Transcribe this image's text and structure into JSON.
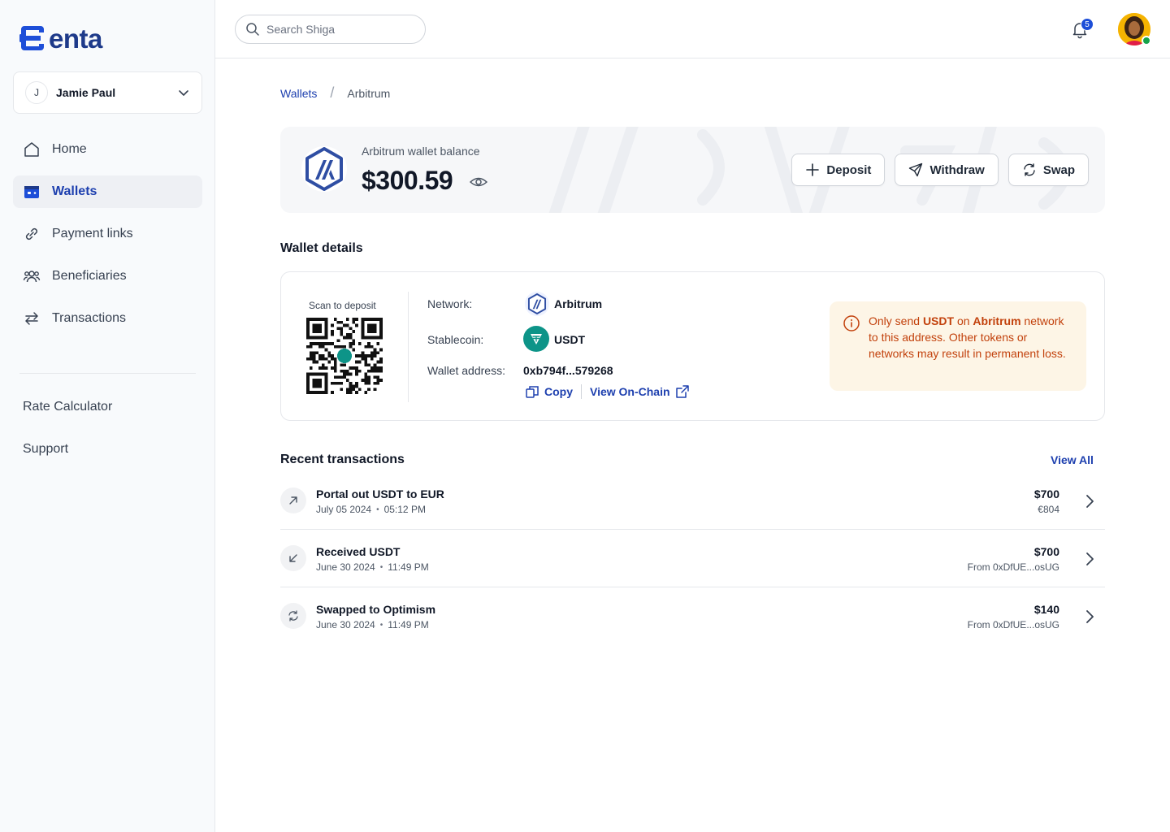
{
  "brand": {
    "name": "enta",
    "color": "#1d4ed8"
  },
  "account": {
    "initial": "J",
    "name": "Jamie Paul"
  },
  "nav": {
    "items": [
      {
        "label": "Home",
        "icon": "home-icon",
        "active": false
      },
      {
        "label": "Wallets",
        "icon": "wallet-icon",
        "active": true
      },
      {
        "label": "Payment links",
        "icon": "link-icon",
        "active": false
      },
      {
        "label": "Beneficiaries",
        "icon": "users-icon",
        "active": false
      },
      {
        "label": "Transactions",
        "icon": "arrows-icon",
        "active": false
      }
    ],
    "secondary": [
      {
        "label": "Rate Calculator"
      },
      {
        "label": "Support"
      }
    ]
  },
  "topbar": {
    "search_placeholder": "Search Shiga",
    "notification_count": "5"
  },
  "breadcrumb": {
    "parent": "Wallets",
    "current": "Arbitrum"
  },
  "balance": {
    "label": "Arbitrum wallet balance",
    "value": "$300.59",
    "actions": {
      "deposit": "Deposit",
      "withdraw": "Withdraw",
      "swap": "Swap"
    }
  },
  "details": {
    "title": "Wallet details",
    "qr_label": "Scan to deposit",
    "network_label": "Network:",
    "network_value": "Arbitrum",
    "stablecoin_label": "Stablecoin:",
    "stablecoin_value": "USDT",
    "address_label": "Wallet address:",
    "address_value": "0xb794f...579268",
    "copy_label": "Copy",
    "view_onchain_label": "View On-Chain",
    "warning": {
      "part1": "Only send ",
      "coin": "USDT",
      "part2": " on ",
      "network": "Abritrum",
      "part3": " network to this address. Other tokens or networks may result in permanent loss."
    }
  },
  "transactions": {
    "title": "Recent transactions",
    "view_all": "View All",
    "items": [
      {
        "title": "Portal out USDT to EUR",
        "date": "July 05 2024",
        "time": "05:12 PM",
        "amount": "$700",
        "sub": "€804",
        "icon": "arrow-up-right-icon"
      },
      {
        "title": "Received USDT",
        "date": "June 30 2024",
        "time": "11:49 PM",
        "amount": "$700",
        "sub": "From 0xDfUE...osUG",
        "icon": "arrow-down-left-icon"
      },
      {
        "title": "Swapped to Optimism",
        "date": "June 30 2024",
        "time": "11:49 PM",
        "amount": "$140",
        "sub": "From 0xDfUE...osUG",
        "icon": "swap-icon"
      }
    ]
  }
}
